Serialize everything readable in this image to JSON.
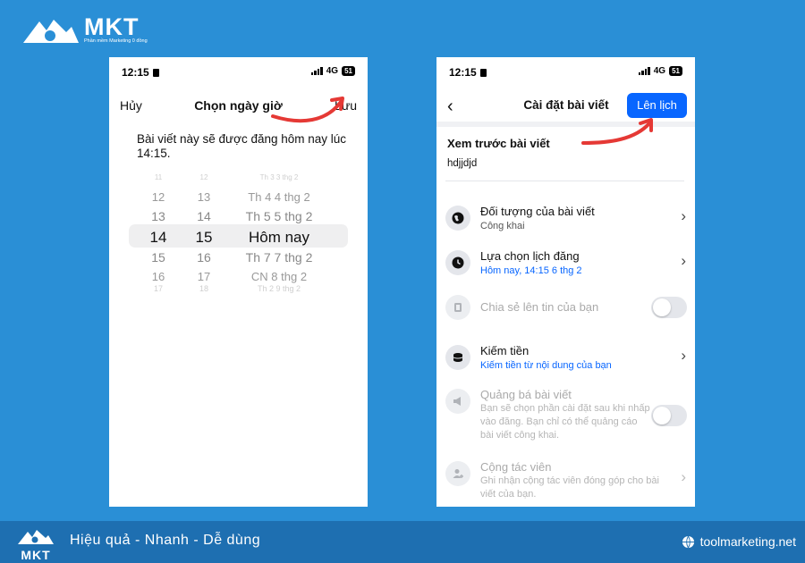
{
  "brand": {
    "name": "MKT",
    "subtitle": "Phần mềm Marketing 0 đồng",
    "tagline": "Hiệu quả - Nhanh  - Dễ dùng",
    "website": "toolmarketing.net"
  },
  "status_bar": {
    "time": "12:15",
    "network": "4G",
    "battery": "51"
  },
  "picker_screen": {
    "cancel_label": "Hủy",
    "title": "Chọn ngày giờ",
    "save_label": "Lưu",
    "message": "Bài viết này sẽ được đăng hôm nay lúc 14:15.",
    "rows": [
      {
        "hour": "11",
        "minute": "12",
        "date": "Th 3 3 thg 2"
      },
      {
        "hour": "12",
        "minute": "13",
        "date": "Th 4 4 thg 2"
      },
      {
        "hour": "13",
        "minute": "14",
        "date": "Th 5 5 thg 2"
      },
      {
        "hour": "14",
        "minute": "15",
        "date": "Hôm nay"
      },
      {
        "hour": "15",
        "minute": "16",
        "date": "Th 7 7 thg 2"
      },
      {
        "hour": "16",
        "minute": "17",
        "date": "CN 8 thg 2"
      },
      {
        "hour": "17",
        "minute": "18",
        "date": "Th 2 9 thg 2"
      }
    ]
  },
  "settings_screen": {
    "title": "Cài đặt bài viết",
    "schedule_button": "Lên lịch",
    "preview_title": "Xem trước bài viết",
    "preview_text": "hdjjdjd",
    "items": [
      {
        "title": "Đối tượng của bài viết",
        "subtitle": "Công khai",
        "icon": "globe-icon"
      },
      {
        "title": "Lựa chọn lịch đăng",
        "subtitle": "Hôm nay, 14:15 6 thg 2",
        "icon": "clock-icon"
      },
      {
        "title": "Chia sẻ lên tin của bạn",
        "subtitle": "",
        "icon": "story-icon"
      },
      {
        "title": "Kiếm tiền",
        "subtitle": "Kiếm tiền từ nội dung của bạn",
        "icon": "coins-icon"
      },
      {
        "title": "Quảng bá bài viết",
        "subtitle": "Bạn sẽ chọn phần cài đặt sau khi nhấp vào đăng. Bạn chỉ có thể quảng cáo bài viết công khai.",
        "icon": "megaphone-icon"
      },
      {
        "title": "Cộng tác viên",
        "subtitle": "Ghi nhận cộng tác viên đóng góp cho bài viết của bạn.",
        "icon": "add-person-icon"
      }
    ],
    "link_color": "#0866ff"
  },
  "colors": {
    "background": "#2a8fd6",
    "footer": "#1e6fb1",
    "primary_button": "#0866ff",
    "annotation_arrow": "#e53935"
  }
}
